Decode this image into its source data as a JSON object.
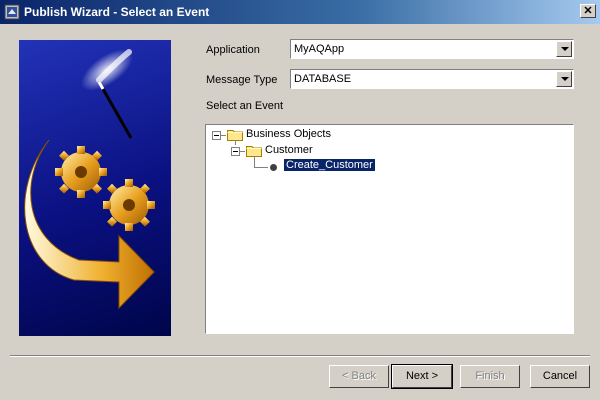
{
  "window": {
    "title": "Publish Wizard - Select an Event",
    "close_label": "✕"
  },
  "form": {
    "application_label": "Application",
    "application_value": "MyAQApp",
    "message_type_label": "Message Type",
    "message_type_value": "DATABASE",
    "event_label": "Select an Event"
  },
  "tree": {
    "root": "Business Objects",
    "child": "Customer",
    "leaf": "Create_Customer"
  },
  "buttons": {
    "back": "< Back",
    "next": "Next >",
    "finish": "Finish",
    "cancel": "Cancel"
  },
  "colors": {
    "dialog_bg": "#d4d0c8",
    "title_bar": "#0a246a",
    "selection": "#0a246a",
    "illustration_bg": "#0a1080",
    "arrow_gold": "#e8a020"
  }
}
